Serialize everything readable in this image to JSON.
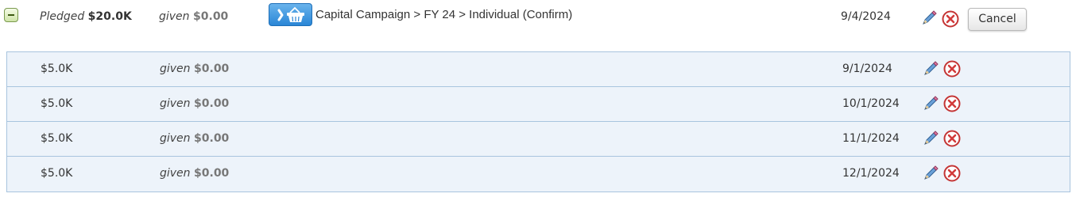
{
  "header": {
    "pledged_label": "Pledged",
    "pledged_amount": "$20.0K",
    "given_label": "given",
    "given_amount": "$0.00",
    "breadcrumb": "Capital Campaign > FY 24 > Individual (Confirm)",
    "date": "9/4/2024",
    "cancel_label": "Cancel"
  },
  "installments": [
    {
      "amount": "$5.0K",
      "given_label": "given",
      "given_amount": "$0.00",
      "date": "9/1/2024"
    },
    {
      "amount": "$5.0K",
      "given_label": "given",
      "given_amount": "$0.00",
      "date": "10/1/2024"
    },
    {
      "amount": "$5.0K",
      "given_label": "given",
      "given_amount": "$0.00",
      "date": "11/1/2024"
    },
    {
      "amount": "$5.0K",
      "given_label": "given",
      "given_amount": "$0.00",
      "date": "12/1/2024"
    }
  ],
  "icons": {
    "collapse": "minus-icon",
    "basket": "basket-icon",
    "edit": "pencil-icon",
    "delete": "close-icon"
  },
  "colors": {
    "row_bg": "#edf3fa",
    "row_border": "#a8c4de",
    "basket_button": "#2a86d6",
    "delete_icon": "#d23b3b"
  }
}
